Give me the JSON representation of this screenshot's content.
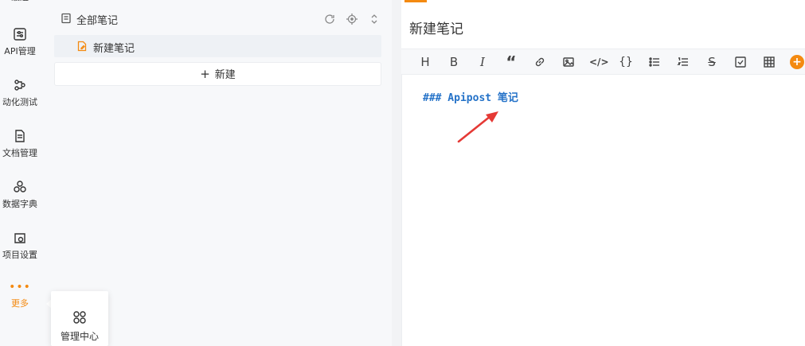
{
  "rail": {
    "items": [
      {
        "label": "最近",
        "icon": "clock-icon"
      },
      {
        "label": "API管理",
        "icon": "api-settings-icon"
      },
      {
        "label": "动化测试",
        "icon": "automation-icon"
      },
      {
        "label": "文档管理",
        "icon": "document-icon"
      },
      {
        "label": "数据字典",
        "icon": "data-dictionary-icon"
      },
      {
        "label": "项目设置",
        "icon": "project-settings-icon"
      },
      {
        "label": "更多",
        "icon": "more-icon"
      }
    ],
    "more_dots": "•••"
  },
  "popover": {
    "label": "管理中心",
    "icon": "grid-apps-icon"
  },
  "tree": {
    "header_label": "全部笔记",
    "items": [
      {
        "label": "新建笔记"
      }
    ],
    "new_button_plus": "+",
    "new_button_label": "新建"
  },
  "editor": {
    "title": "新建笔记",
    "content": "### Apipost 笔记",
    "toolbar": [
      {
        "name": "heading-button",
        "glyph": "H"
      },
      {
        "name": "bold-button",
        "glyph": "B"
      },
      {
        "name": "italic-button",
        "glyph": "I"
      },
      {
        "name": "quote-button",
        "glyph": "“"
      },
      {
        "name": "link-button",
        "glyph": ""
      },
      {
        "name": "image-button",
        "glyph": ""
      },
      {
        "name": "code-button",
        "glyph": "</>"
      },
      {
        "name": "code-block-button",
        "glyph": "{}"
      },
      {
        "name": "bullet-list-button",
        "glyph": ""
      },
      {
        "name": "ordered-list-button",
        "glyph": ""
      },
      {
        "name": "strikethrough-button",
        "glyph": "S"
      },
      {
        "name": "task-list-button",
        "glyph": ""
      },
      {
        "name": "table-button",
        "glyph": ""
      },
      {
        "name": "more-button",
        "glyph": "+"
      }
    ]
  },
  "colors": {
    "accent": "#f48a11",
    "code": "#2472c8",
    "arrow": "#e53935"
  }
}
